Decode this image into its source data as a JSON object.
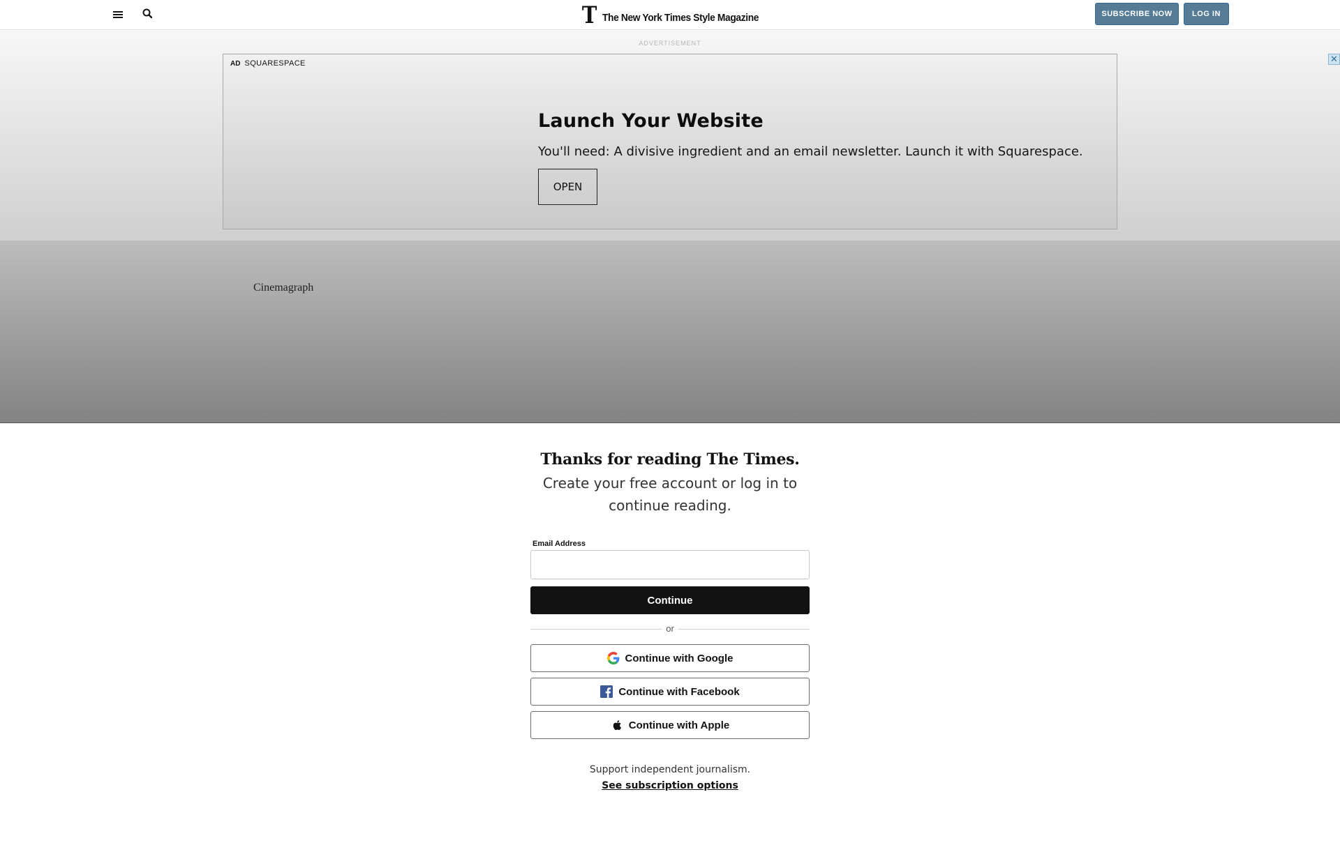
{
  "header": {
    "logo_mark": "T",
    "logo_text": "The New York Times Style Magazine",
    "subscribe_label": "SUBSCRIBE NOW",
    "login_label": "LOG IN",
    "menu_icon": "hamburger-menu-icon",
    "search_icon": "search-icon",
    "button_color": "#567b95"
  },
  "ad": {
    "label": "ADVERTISEMENT",
    "tag": "AD",
    "sponsor": "SQUARESPACE",
    "headline": "Launch Your Website",
    "body": "You'll need: A divisive ingredient and an email newsletter. Launch it with Squarespace.",
    "cta": "OPEN",
    "close_glyph": "✕"
  },
  "media": {
    "alt_text": "Cinemagraph"
  },
  "paywall": {
    "title": "Thanks for reading The Times.",
    "description": "Create your free account or log in to continue reading.",
    "email_label": "Email Address",
    "email_value": "",
    "continue_label": "Continue",
    "divider_text": "or",
    "google_label": "Continue with Google",
    "facebook_label": "Continue with Facebook",
    "apple_label": "Continue with Apple",
    "support_text": "Support independent journalism.",
    "subscription_link": "See subscription options"
  }
}
